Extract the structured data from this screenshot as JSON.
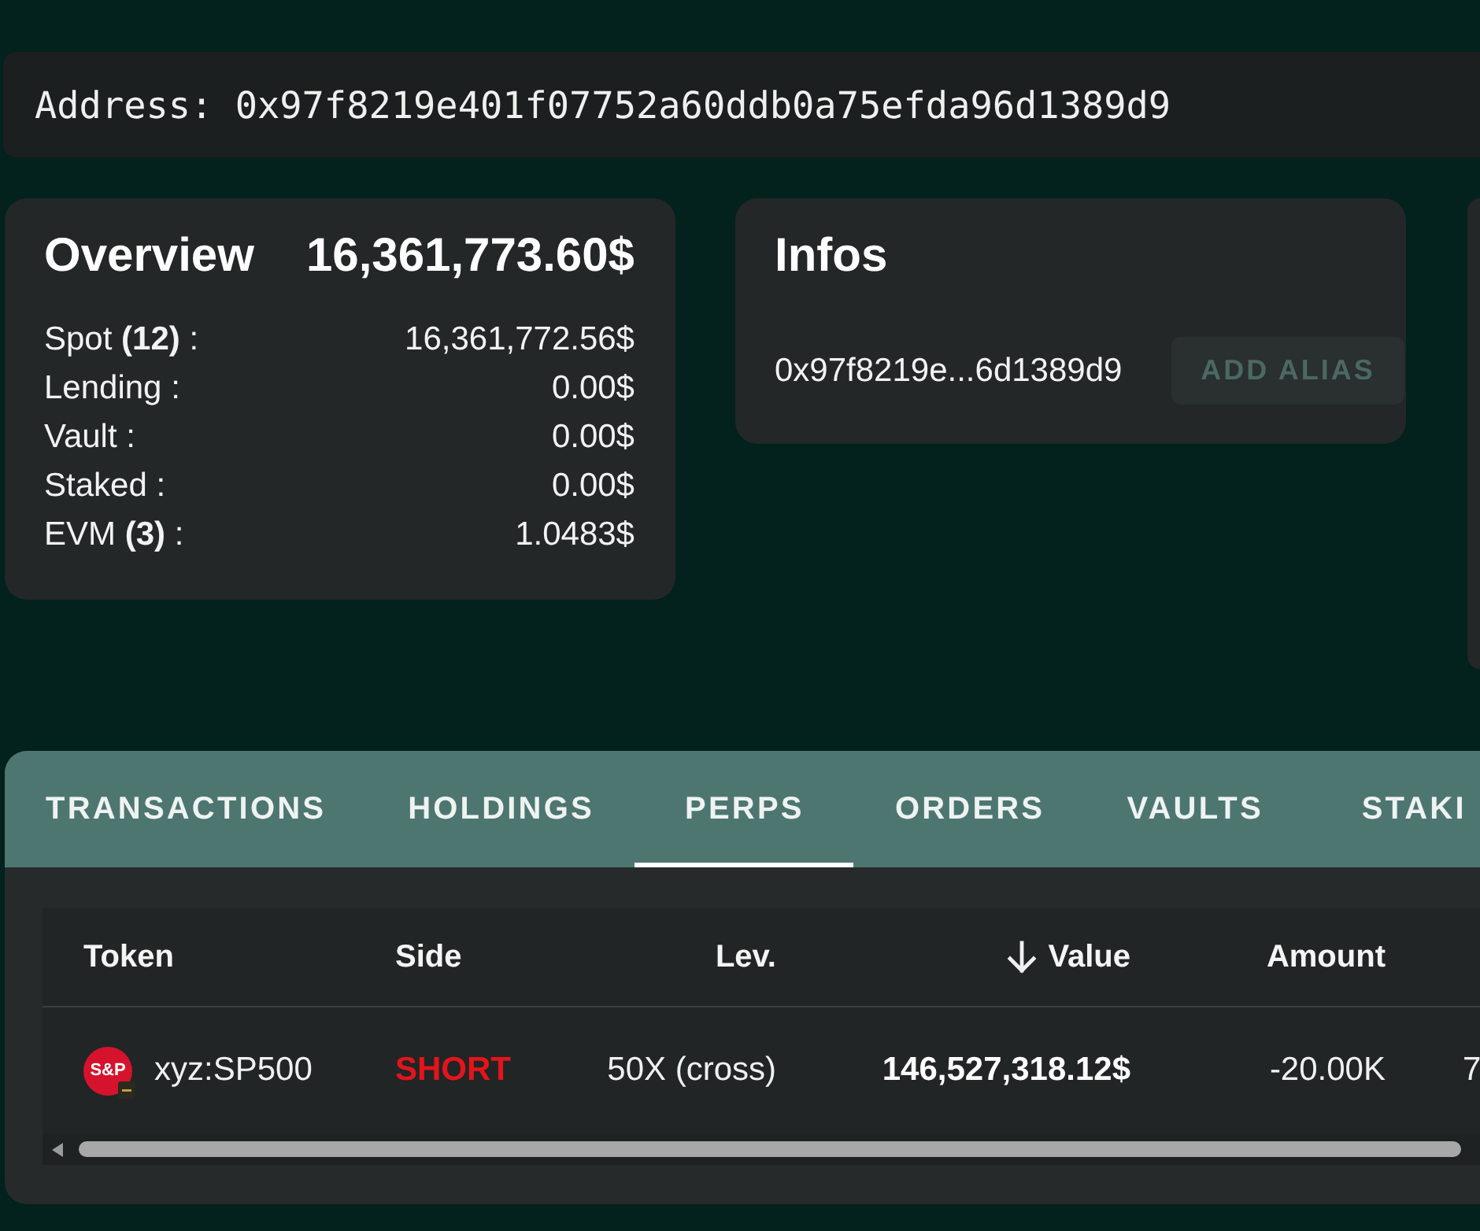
{
  "address_bar": {
    "text": "Address: 0x97f8219e401f07752a60ddb0a75efda96d1389d9"
  },
  "overview": {
    "title": "Overview",
    "total": "16,361,773.60$",
    "rows": [
      {
        "label": "Spot **(12)** :",
        "value": "16,361,772.56$"
      },
      {
        "label": "Lending :",
        "value": "0.00$"
      },
      {
        "label": "Vault :",
        "value": "0.00$"
      },
      {
        "label": "Staked :",
        "value": "0.00$"
      },
      {
        "label": "EVM **(3)** :",
        "value": "1.0483$"
      }
    ]
  },
  "infos": {
    "title": "Infos",
    "address": "0x97f8219e...6d1389d9",
    "button": {
      "label": "ADD ALIAS",
      "disabled": true
    }
  },
  "tabs": [
    {
      "label": "TRANSACTIONS",
      "selected": false
    },
    {
      "label": "HOLDINGS",
      "selected": false
    },
    {
      "label": "PERPS",
      "selected": true
    },
    {
      "label": "ORDERS",
      "selected": false
    },
    {
      "label": "VAULTS",
      "selected": false
    },
    {
      "label": "STAKI",
      "selected": false
    }
  ],
  "table": {
    "columns": [
      {
        "label": "Token",
        "sorted": false
      },
      {
        "label": "Side",
        "sorted": false
      },
      {
        "label": "Lev.",
        "sorted": false
      },
      {
        "label": "Value",
        "sorted": true,
        "descending": true
      },
      {
        "label": "Amount",
        "sorted": false
      }
    ],
    "rows": [
      {
        "token": {
          "logo_text": "S&P",
          "name": "xyz:SP500"
        },
        "side": {
          "label": "SHORT",
          "kind": "short"
        },
        "leverage": "50X (cross)",
        "value": "146,527,318.12$",
        "amount": "-20.00K",
        "column_6": "7"
      }
    ]
  }
}
